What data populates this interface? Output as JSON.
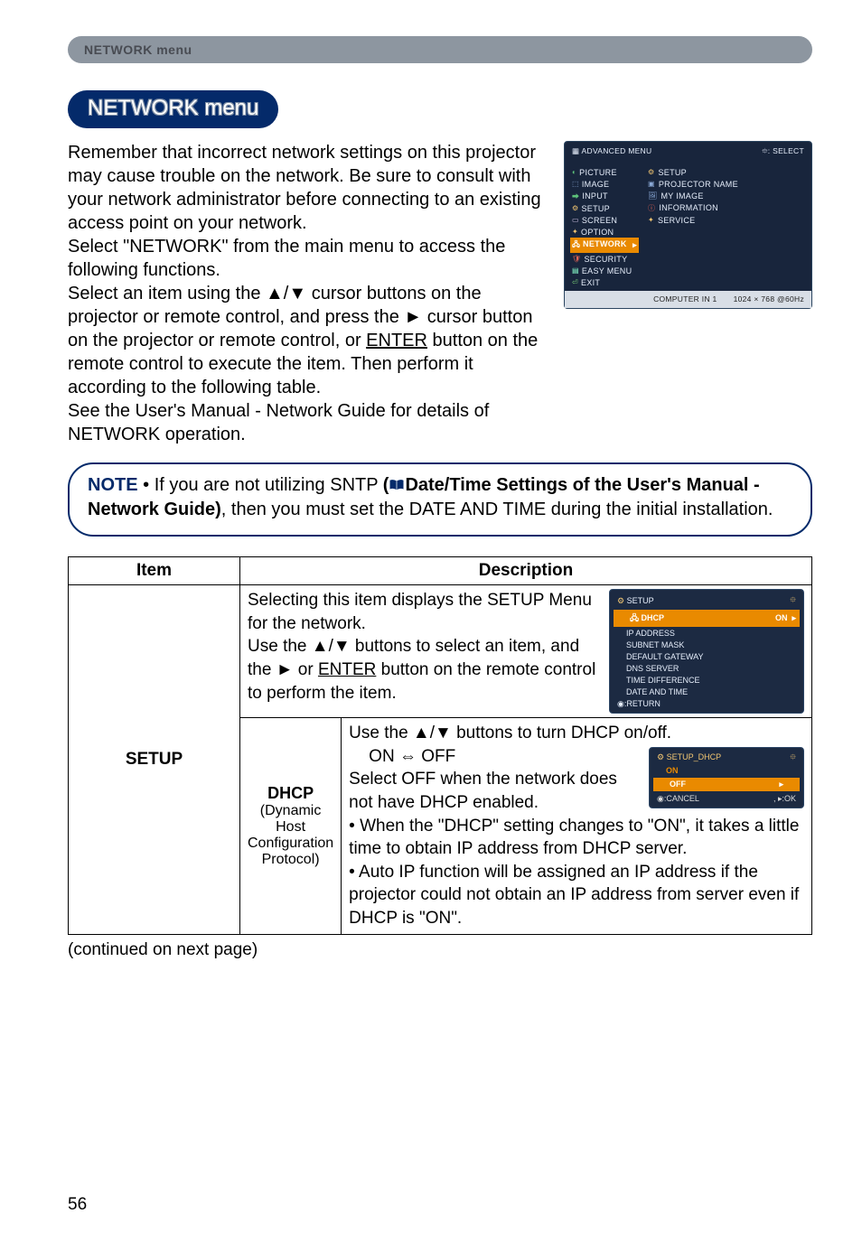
{
  "breadcrumb": "NETWORK menu",
  "title": "NETWORK menu",
  "intro_p1": "Remember that incorrect network settings on this projector may cause trouble on the network. Be sure to consult with your network administrator before connecting to an existing access point on your network.",
  "intro_p2": "Select \"NETWORK\" from the main menu to access the following functions.",
  "intro_p3a": "Select an item using the ▲/▼ cursor buttons on the projector or remote control, and press the ► cursor button on the projector or remote control, or ",
  "intro_p3_key": "ENTER",
  "intro_p3b": " button on the remote control to execute the item. Then perform it according to the following table.",
  "intro_p4": "See the User's Manual - Network Guide for details of NETWORK operation.",
  "note": {
    "lead": "NOTE",
    "sep": " • ",
    "pre": "If you are not utilizing SNTP ",
    "bold_open": "(",
    "bold_link": "Date/Time Settings of the User's Manual - Network Guide)",
    "post": ", then you must set the DATE AND TIME during the initial installation."
  },
  "hero": {
    "header_left": "ADVANCED MENU",
    "header_right_icon": "⯐",
    "header_right": ": SELECT",
    "left": [
      "PICTURE",
      "IMAGE",
      "INPUT",
      "SETUP",
      "SCREEN",
      "OPTION",
      "NETWORK",
      "SECURITY",
      "EASY MENU",
      "EXIT"
    ],
    "right": [
      "SETUP",
      "PROJECTOR NAME",
      "MY IMAGE",
      "INFORMATION",
      "SERVICE"
    ],
    "footer_left": "COMPUTER IN 1",
    "footer_right": "1024 × 768 @60Hz"
  },
  "table": {
    "head_item": "Item",
    "head_desc": "Description",
    "item_label": "SETUP",
    "top_desc_a": "Selecting this item displays the SETUP Menu for the network.",
    "top_desc_b": "Use the ▲/▼ buttons to select an item, and the ► or ",
    "top_desc_key": "ENTER",
    "top_desc_c": " button on the remote control to perform the item.",
    "subitem_main": "DHCP",
    "subitem_sub": "(Dynamic Host Configuration Protocol)",
    "dhcp": {
      "line1": "Use the ▲/▼ buttons to turn DHCP on/off.",
      "onoff": "ON ⇔ OFF",
      "line2": "Select OFF when the network does not have DHCP enabled.",
      "bullet1": "• When the \"DHCP\" setting changes to \"ON\", it takes a little time to obtain IP address from DHCP server.",
      "bullet2": "• Auto IP function will be assigned an IP address if the projector could not obtain an IP address from server even if DHCP is \"ON\"."
    }
  },
  "setup_popup": {
    "title": "SETUP",
    "rows": [
      "DHCP",
      "IP ADDRESS",
      "SUBNET MASK",
      "DEFAULT GATEWAY",
      "DNS SERVER",
      "TIME DIFFERENCE",
      "DATE AND TIME"
    ],
    "row_on": "ON",
    "return": "◉:RETURN"
  },
  "dhcp_popup": {
    "title": "SETUP_DHCP",
    "rows": [
      "ON",
      "OFF"
    ],
    "footer_left": "◉:CANCEL",
    "footer_right": ", ▸:OK"
  },
  "continued": "(continued on next page)",
  "page_num": "56"
}
